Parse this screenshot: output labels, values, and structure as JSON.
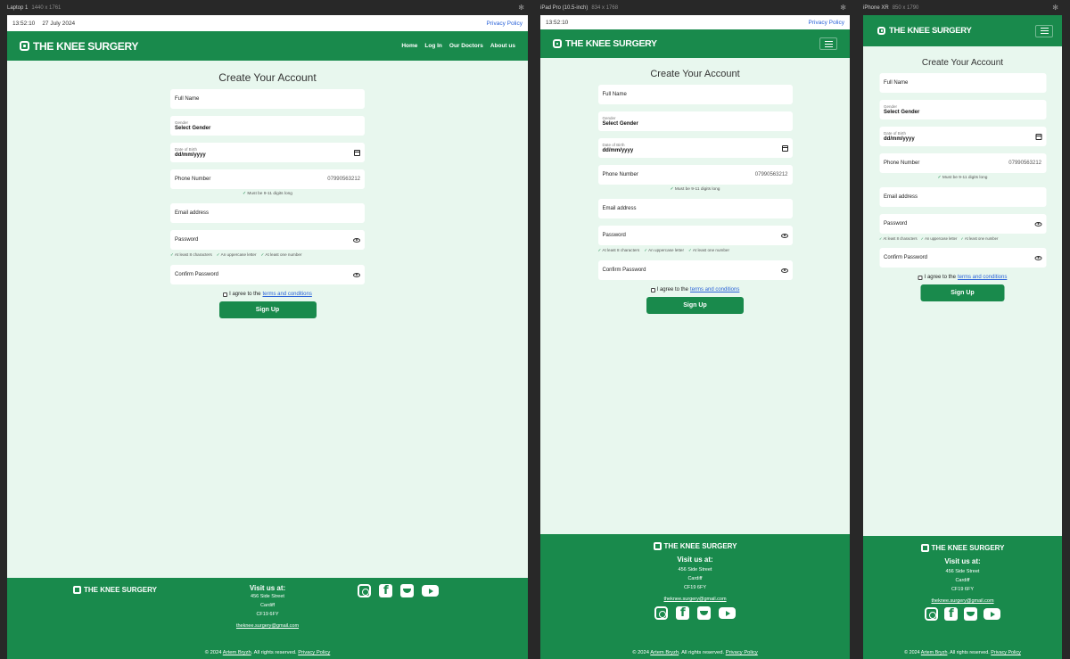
{
  "frames": {
    "laptop": {
      "name": "Laptop 1",
      "size": "1440 x 1761"
    },
    "ipad": {
      "name": "iPad Pro (10.5-inch)",
      "size": "834 x 1768"
    },
    "iphone": {
      "name": "iPhone XR",
      "size": "850 x 1790"
    }
  },
  "topline": {
    "time": "13:52:10",
    "date": "27 July 2024",
    "privacy": "Privacy Policy"
  },
  "brand": "THE KNEE SURGERY",
  "nav": {
    "home": "Home",
    "login": "Log In",
    "doctors": "Our Doctors",
    "about": "About us"
  },
  "form": {
    "title": "Create Your Account",
    "full_name": "Full Name",
    "gender_label": "Gender",
    "gender_value": "Select Gender",
    "dob_label": "Date of Birth",
    "dob_value": "dd/mm/yyyy",
    "phone": "Phone Number",
    "phone_value": "07990563212",
    "phone_hint": "Must be 9-11 digits long",
    "email": "Email address",
    "password": "Password",
    "rule1": "At least 8 characters",
    "rule2": "An uppercase letter",
    "rule3": "At least one number",
    "confirm": "Confirm Password",
    "agree_text": "I agree to the",
    "terms": "terms and conditions",
    "submit": "Sign Up"
  },
  "footer": {
    "visit": "Visit us at:",
    "street": "456 Side Street",
    "city": "Cardiff",
    "postcode": "CF19 6FY",
    "email": "theknee.surgery@gmail.com",
    "copy_pre": "© 2024",
    "author": "Artem Bryzh",
    "copy_mid": ". All rights reserved.",
    "privacy": "Privacy Policy"
  },
  "icons": [
    "laptop-logo-icon",
    "instagram-icon",
    "facebook-icon",
    "twitter-icon",
    "youtube-icon",
    "eye-icon",
    "calendar-icon",
    "check-icon",
    "menu-icon",
    "gear-icon"
  ]
}
